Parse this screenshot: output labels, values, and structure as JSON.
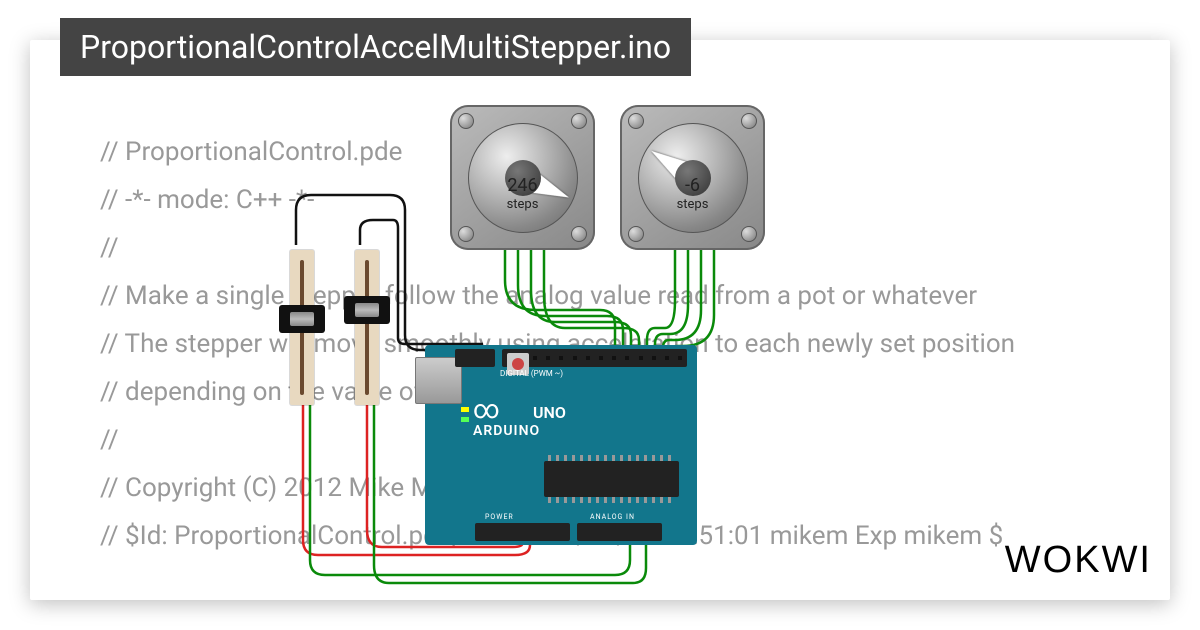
{
  "title": "ProportionalControlAccelMultiStepper.ino",
  "brand": "WOKWI",
  "code": [
    "// ProportionalControl.pde",
    "// -*- mode: C++ -*-",
    "//",
    "// Make a single stepper follow the analog value read from a pot or whatever",
    "// The stepper will move smoothly using acceleration to each newly set position",
    "// depending on the value of the pot.",
    "//",
    "// Copyright (C) 2012 Mike McCauley",
    "// $Id: ProportionalControl.pde,v 1.1 2011/01/05 01:51:01 mikem Exp mikem $"
  ],
  "stepper1": {
    "value": "246",
    "label": "steps",
    "angle": 23
  },
  "stepper2": {
    "value": "-6",
    "label": "steps",
    "angle": 213
  },
  "arduino": {
    "board": "UNO",
    "brand": "ARDUINO",
    "digital": "DIGITAL (PWM ~)",
    "power": "POWER",
    "analog": "ANALOG IN"
  },
  "pot1": {
    "pos_pct": 42
  },
  "pot2": {
    "pos_pct": 34
  }
}
